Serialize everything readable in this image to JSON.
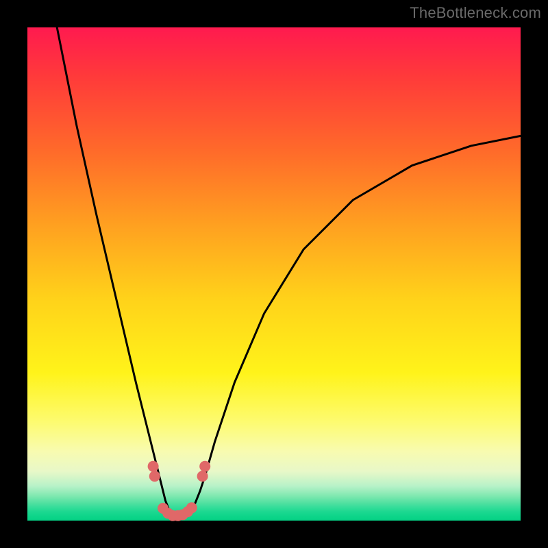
{
  "watermark": "TheBottleneck.com",
  "colors": {
    "frame": "#000000",
    "curve": "#000000",
    "markers": "#e06868",
    "gradient_top": "#ff1a4f",
    "gradient_bottom": "#06d084"
  },
  "chart_data": {
    "type": "line",
    "title": "",
    "xlabel": "",
    "ylabel": "",
    "xlim": [
      0,
      100
    ],
    "ylim": [
      0,
      100
    ],
    "grid": false,
    "legend": false,
    "description": "Bottleneck-style V curve on red→green vertical gradient. Minimum near x≈30. Left branch rises steeply to top-left corner; right branch rises with decreasing slope toward upper-right. Salmon dot markers cluster near the trough.",
    "series": [
      {
        "name": "curve",
        "x": [
          6,
          10,
          14,
          18,
          22,
          24,
          26,
          27,
          28,
          29,
          30,
          31,
          32,
          33,
          34,
          35,
          36,
          38,
          42,
          48,
          56,
          66,
          78,
          90,
          100
        ],
        "y": [
          100,
          80,
          62,
          45,
          28,
          20,
          12,
          8,
          4,
          1.5,
          0.5,
          0.5,
          1,
          2,
          3.5,
          6,
          9,
          16,
          28,
          42,
          55,
          65,
          72,
          76,
          78
        ]
      }
    ],
    "markers": [
      {
        "x": 25.5,
        "y": 11
      },
      {
        "x": 25.8,
        "y": 9
      },
      {
        "x": 27.5,
        "y": 2.5
      },
      {
        "x": 28.5,
        "y": 1.5
      },
      {
        "x": 29.5,
        "y": 1
      },
      {
        "x": 30.5,
        "y": 1
      },
      {
        "x": 31.5,
        "y": 1.2
      },
      {
        "x": 32.5,
        "y": 1.8
      },
      {
        "x": 33.3,
        "y": 2.6
      },
      {
        "x": 35.5,
        "y": 9
      },
      {
        "x": 36.0,
        "y": 11
      }
    ]
  }
}
